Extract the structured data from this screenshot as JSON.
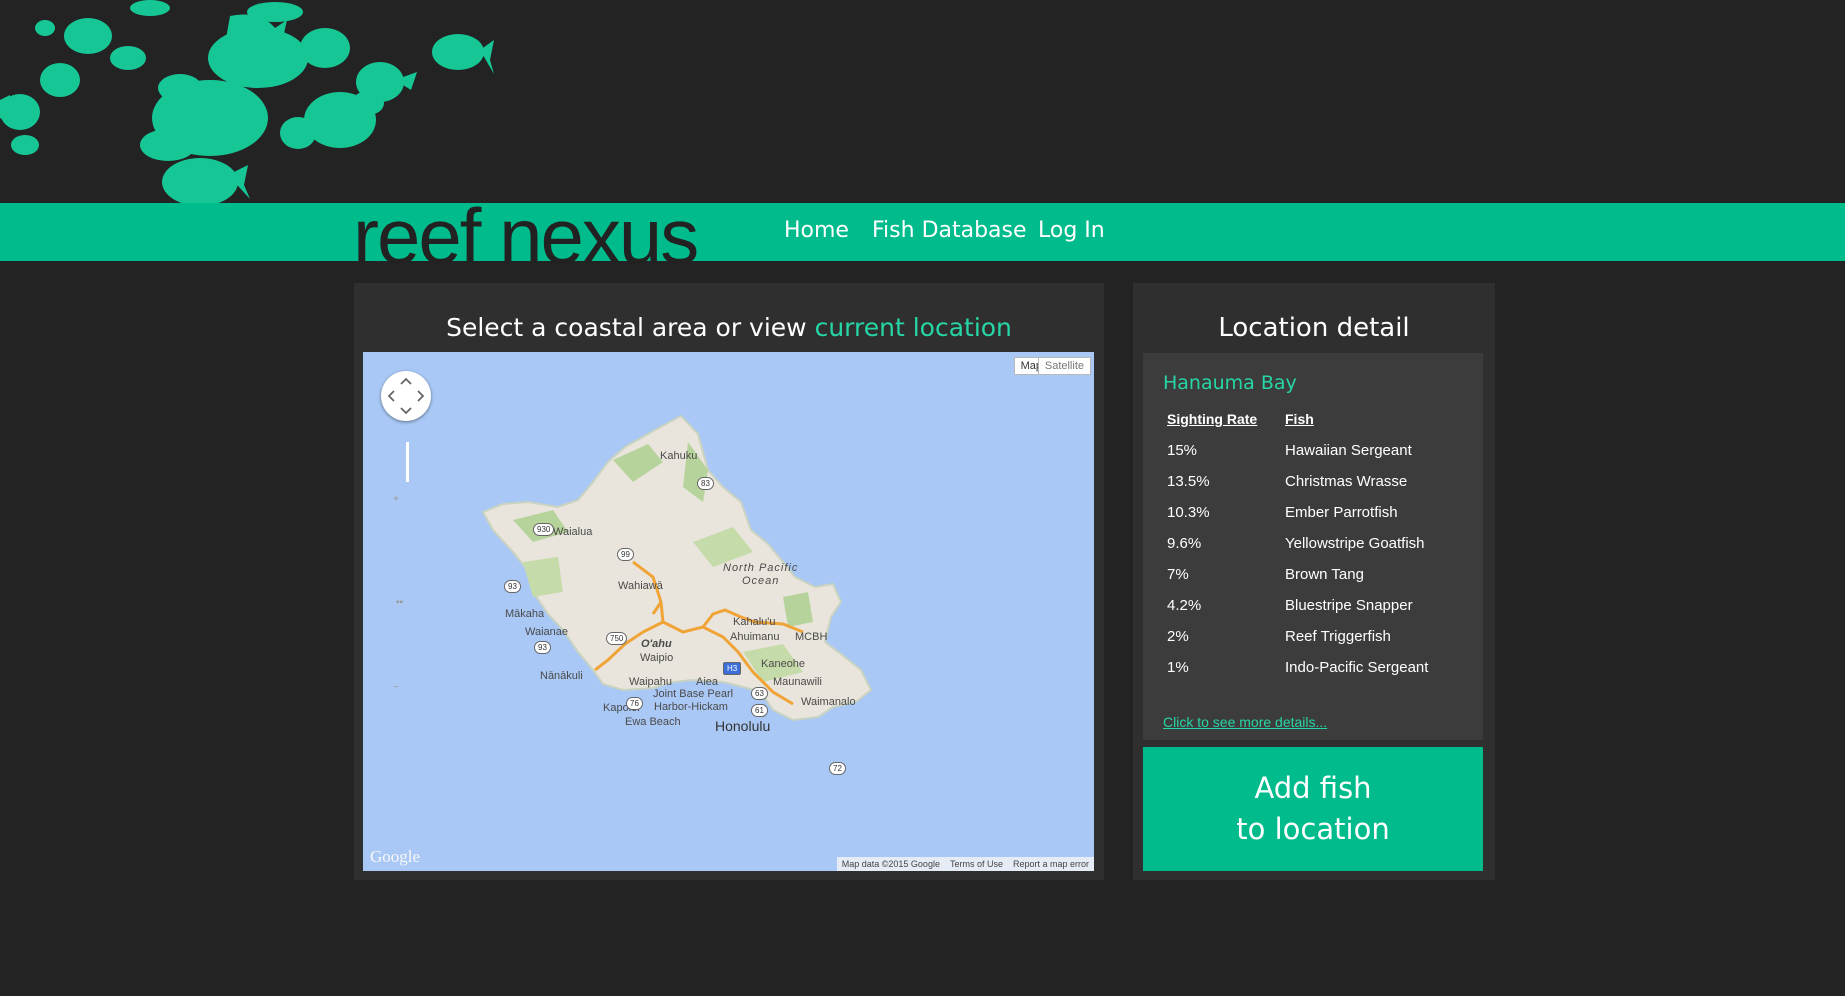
{
  "brand": {
    "logo": "reef nexus",
    "accent_color": "#00bb8c",
    "highlight_color": "#26d6a6"
  },
  "nav": {
    "items": [
      {
        "label": "Home"
      },
      {
        "label": "Fish Database"
      },
      {
        "label": "Log In"
      }
    ]
  },
  "map_panel": {
    "title_prefix": "Select a coastal area or view ",
    "title_link": "current location",
    "map": {
      "type_buttons": [
        "Map",
        "Satellite"
      ],
      "ocean_label": [
        "North Pacific",
        "Ocean"
      ],
      "island_label": "O'ahu",
      "places": [
        "Kahuku",
        "Waialua",
        "Wahiawā",
        "Mākaha",
        "Waianae",
        "Nānākuli",
        "Waipio",
        "Waipahu",
        "Aiea",
        "Kahalu'u",
        "Ahuimanu",
        "MCBH",
        "Kaneohe",
        "Maunawili",
        "Waimanalo",
        "Kapolei",
        "Joint Base Pearl",
        "Harbor-Hickam",
        "Ewa Beach",
        "Honolulu"
      ],
      "highways": [
        "83",
        "930",
        "99",
        "93",
        "750",
        "93",
        "H3",
        "63",
        "61",
        "76",
        "72"
      ],
      "logo": "Google",
      "attribution": [
        "Map data ©2015 Google",
        "Terms of Use",
        "Report a map error"
      ],
      "icons": [
        "pan-control-icon",
        "zoom-slider-icon",
        "pegman-icon"
      ]
    }
  },
  "detail_panel": {
    "title": "Location detail",
    "location_name": "Hanauma Bay",
    "table": {
      "headers": [
        "Sighting Rate",
        "Fish"
      ],
      "rows": [
        {
          "rate": "15%",
          "fish": "Hawaiian Sergeant"
        },
        {
          "rate": "13.5%",
          "fish": "Christmas Wrasse"
        },
        {
          "rate": "10.3%",
          "fish": "Ember Parrotfish"
        },
        {
          "rate": "9.6%",
          "fish": "Yellowstripe Goatfish"
        },
        {
          "rate": "7%",
          "fish": "Brown Tang"
        },
        {
          "rate": "4.2%",
          "fish": "Bluestripe Snapper"
        },
        {
          "rate": "2%",
          "fish": "Reef Triggerfish"
        },
        {
          "rate": "1%",
          "fish": "Indo-Pacific Sergeant"
        }
      ]
    },
    "more_link": "Click to see more details...",
    "add_button": [
      "Add fish",
      "to location"
    ]
  }
}
